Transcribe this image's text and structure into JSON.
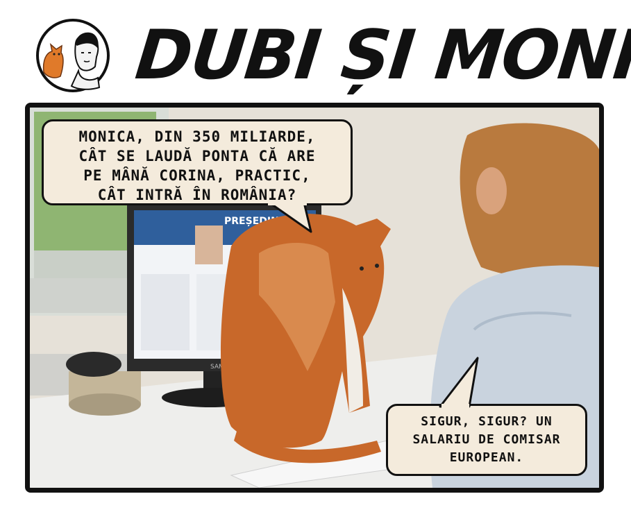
{
  "comic": {
    "title": "DUBI ȘI MONICA",
    "bubble_1": {
      "lines": [
        "MONICA, DIN 350 MILIARDE,",
        "CÂT SE LAUDĂ PONTA CĂ ARE",
        "PE MÂNĂ CORINA, PRACTIC,",
        "CÂT INTRĂ ÎN ROMÂNIA?"
      ]
    },
    "bubble_2": {
      "lines": [
        "SIGUR, SIGUR? UN",
        "SALARIU DE COMISAR",
        "EUROPEAN."
      ]
    },
    "monitor_screen": {
      "banner_text": "PREȘEDINTE",
      "brand": "SAMSUNG"
    }
  },
  "colors": {
    "speech_bubble_fill": "#f4ebdc",
    "panel_border": "#111111",
    "cat_orange": "#c8682a",
    "screen_blue": "#2f5f9c"
  }
}
